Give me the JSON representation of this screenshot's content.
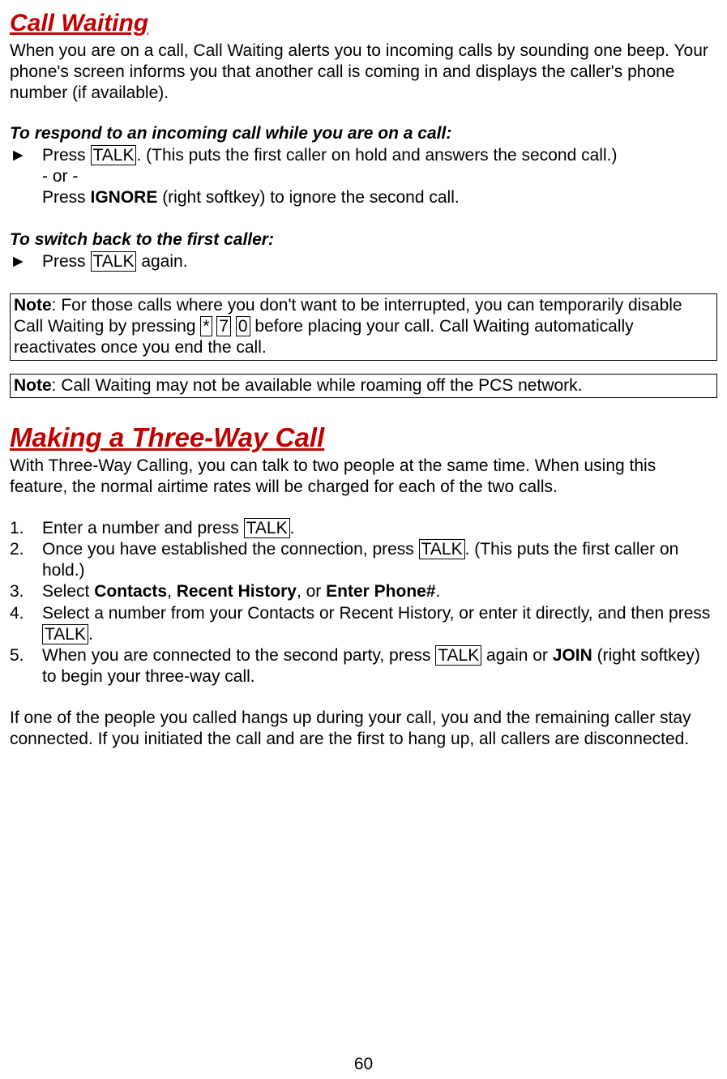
{
  "sec1": {
    "title": "Call Waiting",
    "intro": "When you are on a call, Call Waiting alerts you to incoming calls by sounding one beep. Your phone's screen informs you that another call is coming in and displays the caller's phone number (if available).",
    "sub1": "To respond to an incoming call while you are on a call:",
    "b1a": "Press ",
    "b1_key": "TALK",
    "b1b": ". (This puts the first caller on hold and answers the second call.)",
    "or": "- or -",
    "b2a": "Press ",
    "b2_bold": "IGNORE",
    "b2b": " (right softkey) to ignore the second call.",
    "sub2": "To switch back to the first caller:",
    "b3a": "Press ",
    "b3_key": "TALK",
    "b3b": " again.",
    "note1_label": "Note",
    "note1_a": ": For those calls where you don't want to be interrupted, you can temporarily disable Call Waiting by pressing ",
    "note1_k1": "*",
    "note1_k2": "7",
    "note1_k3": "0",
    "note1_b": " before placing your call. Call Waiting automatically reactivates once you end the call.",
    "note2_label": "Note",
    "note2_body": ": Call Waiting may not be available while roaming off the PCS network."
  },
  "sec2": {
    "title": "Making a Three-Way Call",
    "intro": "With Three-Way Calling, you can talk to two people at the same time. When using this feature, the normal airtime rates will be charged for each of the two calls.",
    "n1": "1.",
    "s1a": "Enter a number and press ",
    "s1_key": "TALK",
    "s1b": ".",
    "n2": "2.",
    "s2a": "Once you have established the connection, press ",
    "s2_key": "TALK",
    "s2b": ". (This puts the first caller on hold.)",
    "n3": "3.",
    "s3a": "Select ",
    "s3_b1": "Contacts",
    "s3_c1": ", ",
    "s3_b2": "Recent History",
    "s3_c2": ", or ",
    "s3_b3": "Enter Phone#",
    "s3_end": ".",
    "n4": "4.",
    "s4a": "Select a number from your Contacts or Recent History, or enter it directly, and then press ",
    "s4_key": "TALK",
    "s4b": ".",
    "n5": "5.",
    "s5a": "When you are connected to the second party, press ",
    "s5_key": "TALK",
    "s5b": " again or ",
    "s5_bold": "JOIN",
    "s5c": " (right softkey) to begin your three-way call.",
    "outro": "If one of the people you called hangs up during your call, you and the remaining caller stay connected. If you initiated the call and are the first to hang up, all callers are disconnected."
  },
  "page": "60",
  "glyph_bullet": "►"
}
